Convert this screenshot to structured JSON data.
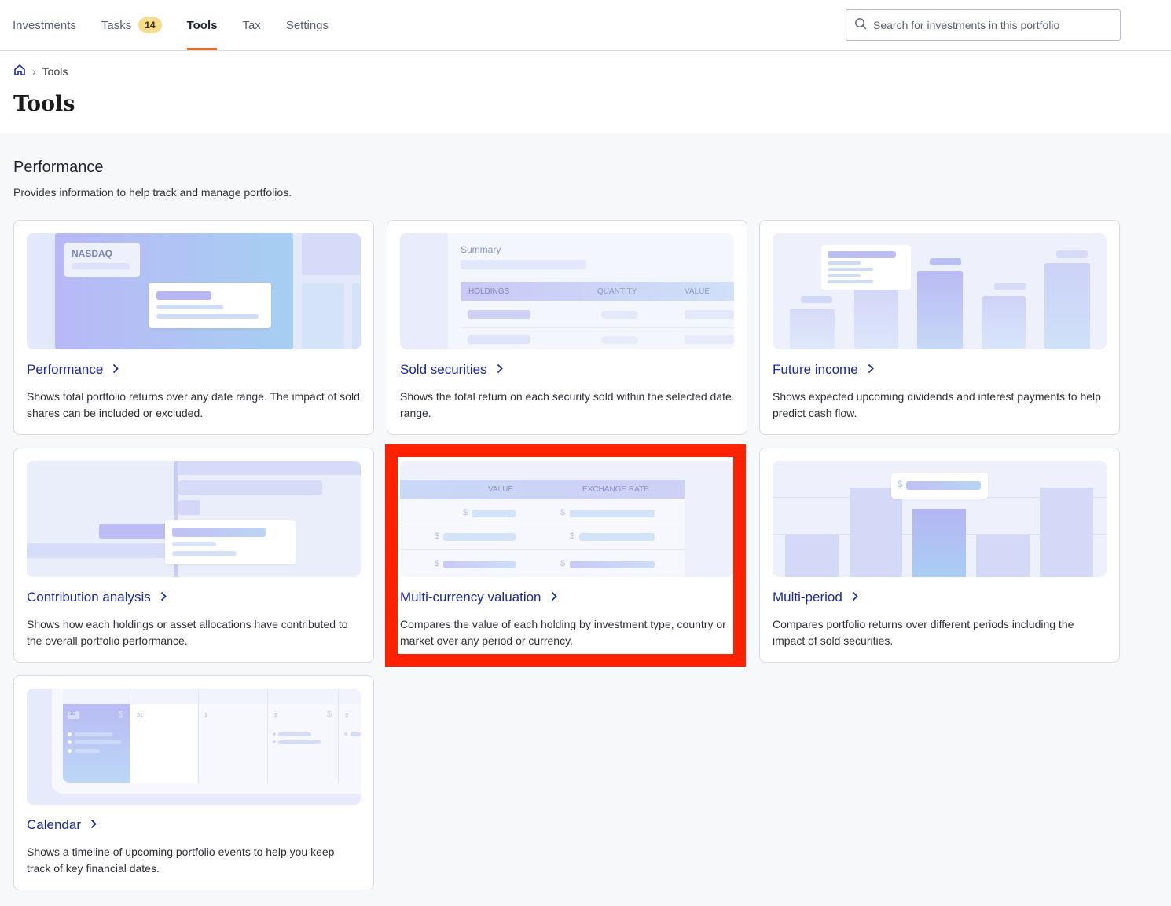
{
  "nav": {
    "tabs": [
      {
        "label": "Investments"
      },
      {
        "label": "Tasks",
        "badge": "14"
      },
      {
        "label": "Tools"
      },
      {
        "label": "Tax"
      },
      {
        "label": "Settings"
      }
    ],
    "search_placeholder": "Search for investments in this portfolio"
  },
  "breadcrumb": {
    "current": "Tools"
  },
  "page_title": "Tools",
  "section": {
    "title": "Performance",
    "description": "Provides information to help track and manage portfolios."
  },
  "cards": [
    {
      "title": "Performance",
      "description": "Shows total portfolio returns over any date range. The impact of sold shares can be included or excluded.",
      "illus_label": "NASDAQ"
    },
    {
      "title": "Sold securities",
      "description": "Shows the total return on each security sold within the selected date range.",
      "illus_label": "Summary",
      "columns": [
        "HOLDINGS",
        "QUANTITY",
        "VALUE"
      ]
    },
    {
      "title": "Future income",
      "description": "Shows expected upcoming dividends and interest payments to help predict cash flow."
    },
    {
      "title": "Contribution analysis",
      "description": "Shows how each holdings or asset allocations have contributed to the overall portfolio performance."
    },
    {
      "title": "Multi-currency valuation",
      "description": "Compares the value of each holding by investment type, country or market over any period or currency.",
      "columns": [
        "VALUE",
        "EXCHANGE RATE"
      ]
    },
    {
      "title": "Multi-period",
      "description": "Compares portfolio returns over different periods including the impact of sold securities."
    },
    {
      "title": "Calendar",
      "description": "Shows a timeline of upcoming portfolio events to help you keep track of key financial dates.",
      "days": [
        "30",
        "31",
        "1",
        "2",
        "3"
      ]
    }
  ],
  "colors": {
    "accent": "#f26a21",
    "link": "#1a2a9c",
    "highlight": "#ff2200"
  }
}
